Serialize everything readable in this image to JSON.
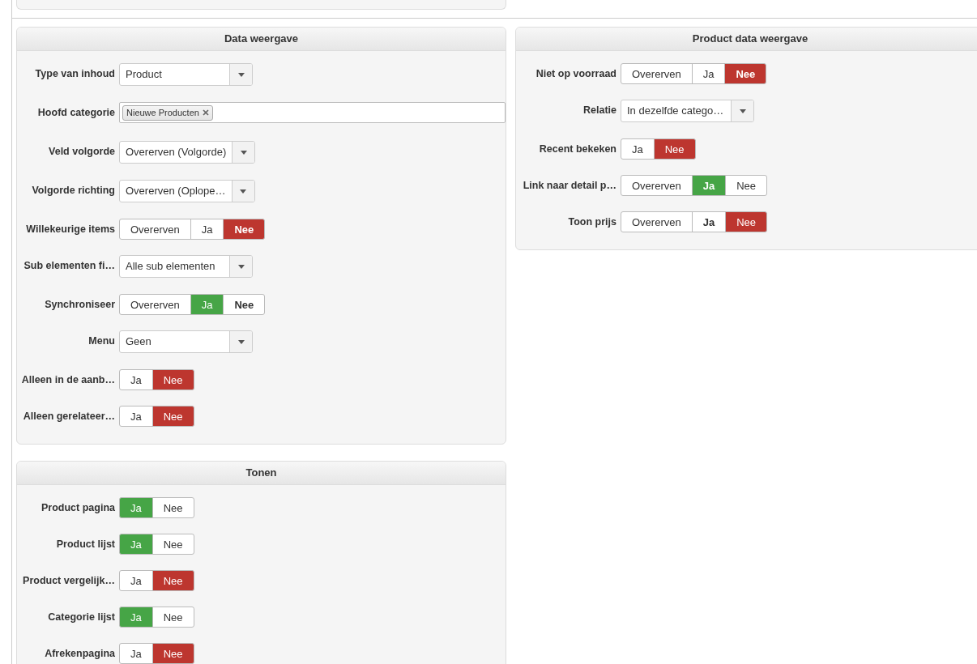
{
  "columns": [
    {
      "panels": [
        {
          "title": "Data weergave",
          "fields": [
            {
              "kind": "select",
              "label": "Type van inhoud",
              "value": "Product"
            },
            {
              "kind": "tags",
              "label": "Hoofd categorie",
              "tags": [
                "Nieuwe Producten"
              ]
            },
            {
              "kind": "select",
              "label": "Veld volgorde",
              "value": "Overerven (Volgorde)"
            },
            {
              "kind": "select",
              "label": "Volgorde richting",
              "value": "Overerven (Oplope…"
            },
            {
              "kind": "toggle",
              "label": "Willekeurige items",
              "options": [
                {
                  "label": "Overerven",
                  "selected": false,
                  "bold": false
                },
                {
                  "label": "Ja",
                  "selected": false,
                  "bold": false
                },
                {
                  "label": "Nee",
                  "selected": true,
                  "bold": true,
                  "color": "#bd362f"
                }
              ]
            },
            {
              "kind": "select",
              "label": "Sub elementen fi…",
              "value": "Alle sub elementen"
            },
            {
              "kind": "toggle",
              "label": "Synchroniseer",
              "options": [
                {
                  "label": "Overerven",
                  "selected": false,
                  "bold": false
                },
                {
                  "label": "Ja",
                  "selected": true,
                  "bold": false,
                  "color": "#46a546"
                },
                {
                  "label": "Nee",
                  "selected": false,
                  "bold": true
                }
              ]
            },
            {
              "kind": "select",
              "label": "Menu",
              "value": "Geen"
            },
            {
              "kind": "toggle",
              "label": "Alleen in de aanb…",
              "options": [
                {
                  "label": "Ja",
                  "selected": false,
                  "bold": false
                },
                {
                  "label": "Nee",
                  "selected": true,
                  "bold": false,
                  "color": "#bd362f"
                }
              ]
            },
            {
              "kind": "toggle",
              "label": "Alleen gerelateer…",
              "options": [
                {
                  "label": "Ja",
                  "selected": false,
                  "bold": false
                },
                {
                  "label": "Nee",
                  "selected": true,
                  "bold": false,
                  "color": "#bd362f"
                }
              ]
            }
          ]
        },
        {
          "title": "Tonen",
          "fields": [
            {
              "kind": "toggle",
              "label": "Product pagina",
              "options": [
                {
                  "label": "Ja",
                  "selected": true,
                  "bold": false,
                  "color": "#46a546"
                },
                {
                  "label": "Nee",
                  "selected": false,
                  "bold": false
                }
              ]
            },
            {
              "kind": "toggle",
              "label": "Product lijst",
              "options": [
                {
                  "label": "Ja",
                  "selected": true,
                  "bold": false,
                  "color": "#46a546"
                },
                {
                  "label": "Nee",
                  "selected": false,
                  "bold": false
                }
              ]
            },
            {
              "kind": "toggle",
              "label": "Product vergelijk…",
              "options": [
                {
                  "label": "Ja",
                  "selected": false,
                  "bold": false
                },
                {
                  "label": "Nee",
                  "selected": true,
                  "bold": false,
                  "color": "#bd362f"
                }
              ]
            },
            {
              "kind": "toggle",
              "label": "Categorie lijst",
              "options": [
                {
                  "label": "Ja",
                  "selected": true,
                  "bold": false,
                  "color": "#46a546"
                },
                {
                  "label": "Nee",
                  "selected": false,
                  "bold": false
                }
              ]
            },
            {
              "kind": "toggle",
              "label": "Afrekenpagina",
              "options": [
                {
                  "label": "Ja",
                  "selected": false,
                  "bold": false
                },
                {
                  "label": "Nee",
                  "selected": true,
                  "bold": false,
                  "color": "#bd362f"
                }
              ]
            }
          ]
        }
      ]
    },
    {
      "panels": [
        {
          "title": "Product data weergave",
          "fields": [
            {
              "kind": "toggle",
              "label": "Niet op voorraad",
              "options": [
                {
                  "label": "Overerven",
                  "selected": false,
                  "bold": false
                },
                {
                  "label": "Ja",
                  "selected": false,
                  "bold": false
                },
                {
                  "label": "Nee",
                  "selected": true,
                  "bold": true,
                  "color": "#bd362f"
                }
              ]
            },
            {
              "kind": "select",
              "label": "Relatie",
              "value": "In dezelfde catego…"
            },
            {
              "kind": "toggle",
              "label": "Recent bekeken",
              "options": [
                {
                  "label": "Ja",
                  "selected": false,
                  "bold": false
                },
                {
                  "label": "Nee",
                  "selected": true,
                  "bold": false,
                  "color": "#bd362f"
                }
              ]
            },
            {
              "kind": "toggle",
              "label": "Link naar detail p…",
              "options": [
                {
                  "label": "Overerven",
                  "selected": false,
                  "bold": false
                },
                {
                  "label": "Ja",
                  "selected": true,
                  "bold": true,
                  "color": "#46a546"
                },
                {
                  "label": "Nee",
                  "selected": false,
                  "bold": false
                }
              ]
            },
            {
              "kind": "toggle",
              "label": "Toon prijs",
              "options": [
                {
                  "label": "Overerven",
                  "selected": false,
                  "bold": false
                },
                {
                  "label": "Ja",
                  "selected": false,
                  "bold": true
                },
                {
                  "label": "Nee",
                  "selected": true,
                  "bold": false,
                  "color": "#bd362f"
                }
              ]
            }
          ]
        }
      ]
    }
  ]
}
